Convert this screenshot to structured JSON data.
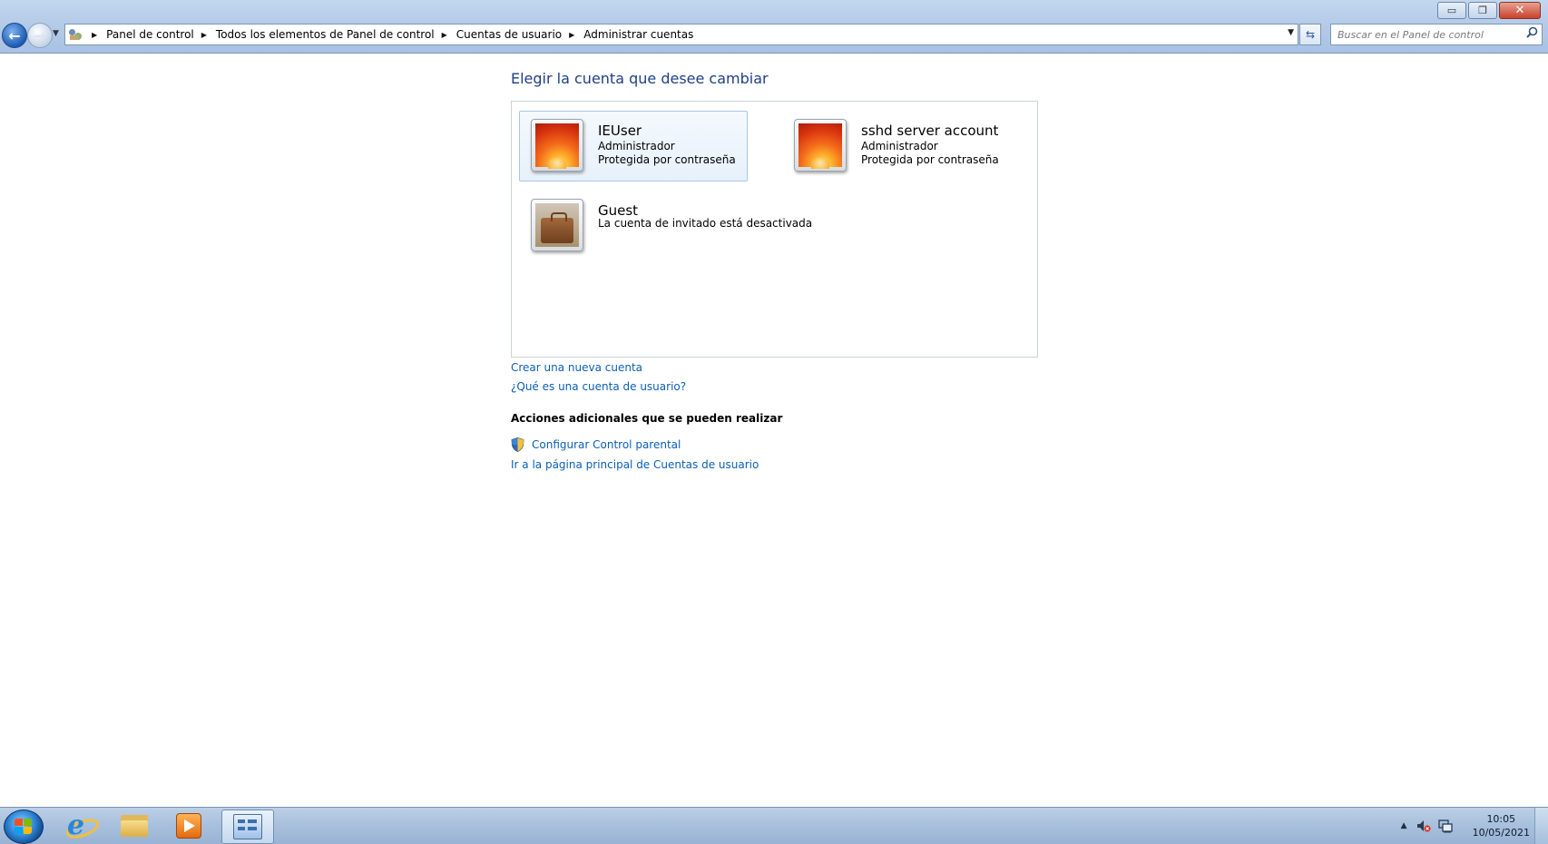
{
  "window": {
    "controls": {
      "minimize": "▭",
      "restore": "❐",
      "close": "✕"
    }
  },
  "navigation": {
    "back_glyph": "←",
    "forward_glyph": "→",
    "dropdown_glyph": "▼"
  },
  "address_bar": {
    "icon": "control-panel-icon",
    "separator": "▶",
    "breadcrumbs": [
      "Panel de control",
      "Todos los elementos de Panel de control",
      "Cuentas de usuario",
      "Administrar cuentas"
    ],
    "dropdown_glyph": "▼",
    "refresh_glyph": "⇆"
  },
  "search": {
    "placeholder": "Buscar en el Panel de control",
    "icon": "search-icon"
  },
  "main": {
    "title": "Elegir la cuenta que desee cambiar",
    "accounts": [
      {
        "name": "IEUser",
        "line1": "Administrador",
        "line2": "Protegida por contraseña",
        "picture": "flower-avatar",
        "selected": true
      },
      {
        "name": "sshd server account",
        "line1": "Administrador",
        "line2": "Protegida por contraseña",
        "picture": "flower-avatar",
        "selected": false
      },
      {
        "name": "Guest",
        "line1": "La cuenta de invitado está desactivada",
        "line2": "",
        "picture": "briefcase-avatar",
        "selected": false
      }
    ],
    "links": {
      "create": "Crear una nueva cuenta",
      "what_is": "¿Qué es una cuenta de usuario?"
    },
    "additional": {
      "heading": "Acciones adicionales que se pueden realizar",
      "parental": "Configurar Control parental",
      "home": "Ir a la página principal de Cuentas de usuario"
    }
  },
  "taskbar": {
    "items": [
      "start-button",
      "internet-explorer",
      "windows-explorer",
      "media-player",
      "control-panel"
    ],
    "active_item": "control-panel",
    "tray": {
      "arrow": "▲",
      "icons": [
        "volume-muted-icon",
        "network-icon"
      ]
    },
    "clock": {
      "time": "10:05",
      "date": "10/05/2021"
    }
  },
  "colors": {
    "link": "#0b5fb5",
    "title": "#1e3f87",
    "selection_border": "#a8c8e6",
    "titlebar": "#b6cce8"
  }
}
